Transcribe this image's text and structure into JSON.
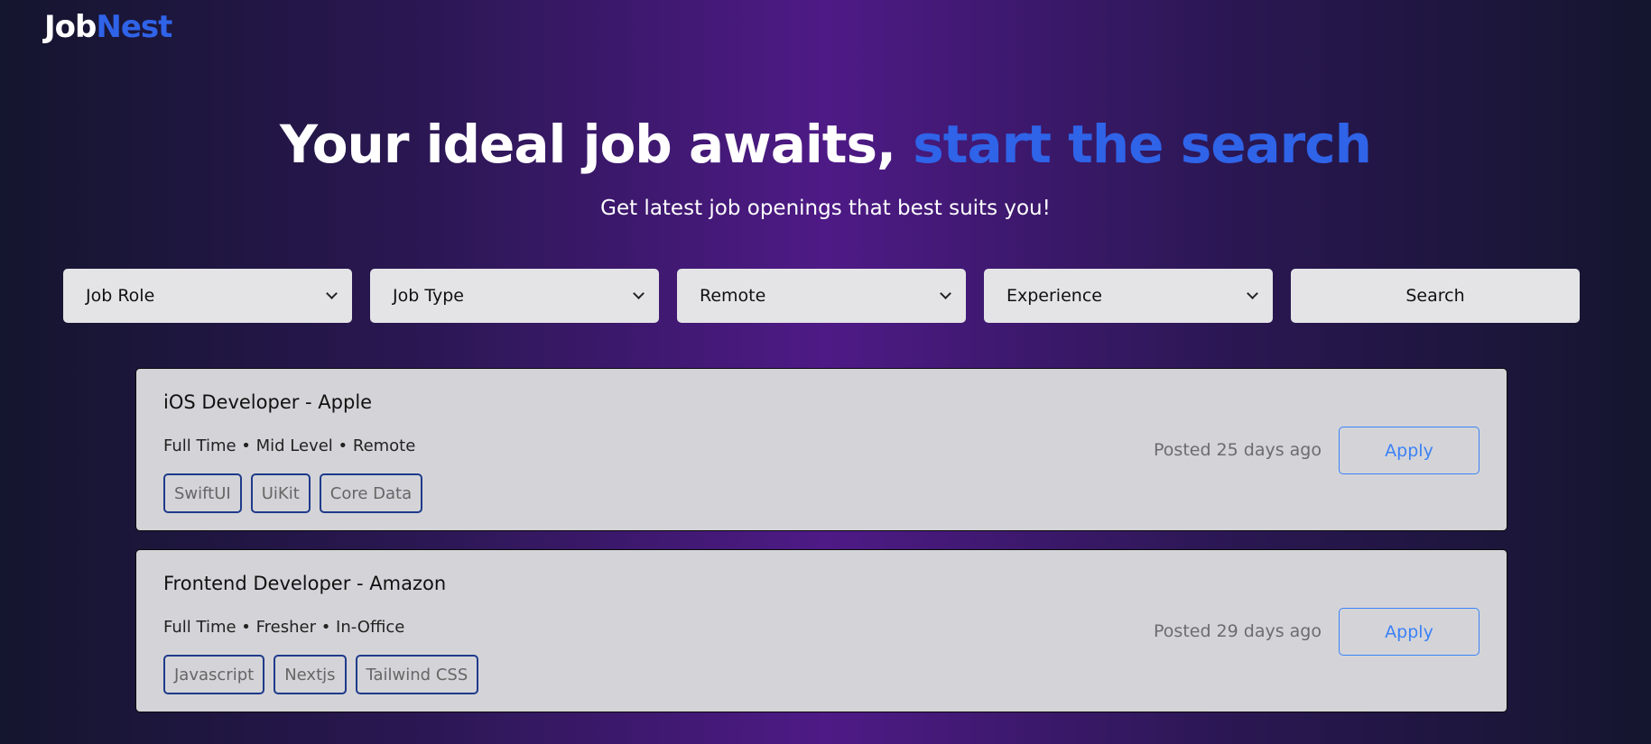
{
  "brand": {
    "logo_part1": "Job",
    "logo_part2": "Nest"
  },
  "hero": {
    "title_white": "Your ideal job awaits, ",
    "title_blue": "start the search",
    "subtitle": "Get latest job openings that best suits you!"
  },
  "filters": {
    "job_role": "Job Role",
    "job_type": "Job Type",
    "remote": "Remote",
    "experience": "Experience",
    "search_label": "Search"
  },
  "jobs": [
    {
      "title": "iOS Developer - Apple",
      "meta": "Full Time • Mid Level • Remote",
      "tags": [
        "SwiftUI",
        "UiKit",
        "Core Data"
      ],
      "posted": "Posted 25 days ago",
      "apply_label": "Apply"
    },
    {
      "title": "Frontend Developer - Amazon",
      "meta": "Full Time • Fresher • In-Office",
      "tags": [
        "Javascript",
        "Nextjs",
        "Tailwind CSS"
      ],
      "posted": "Posted 29 days ago",
      "apply_label": "Apply"
    }
  ],
  "colors": {
    "accent_blue": "#2f63e8",
    "apply_blue": "#3b82f6",
    "tag_border": "#1e3a8a",
    "card_bg": "#d4d4d8",
    "filter_bg": "#e4e4e7"
  },
  "icons": {
    "select_arrow": "chevron-down-icon"
  }
}
